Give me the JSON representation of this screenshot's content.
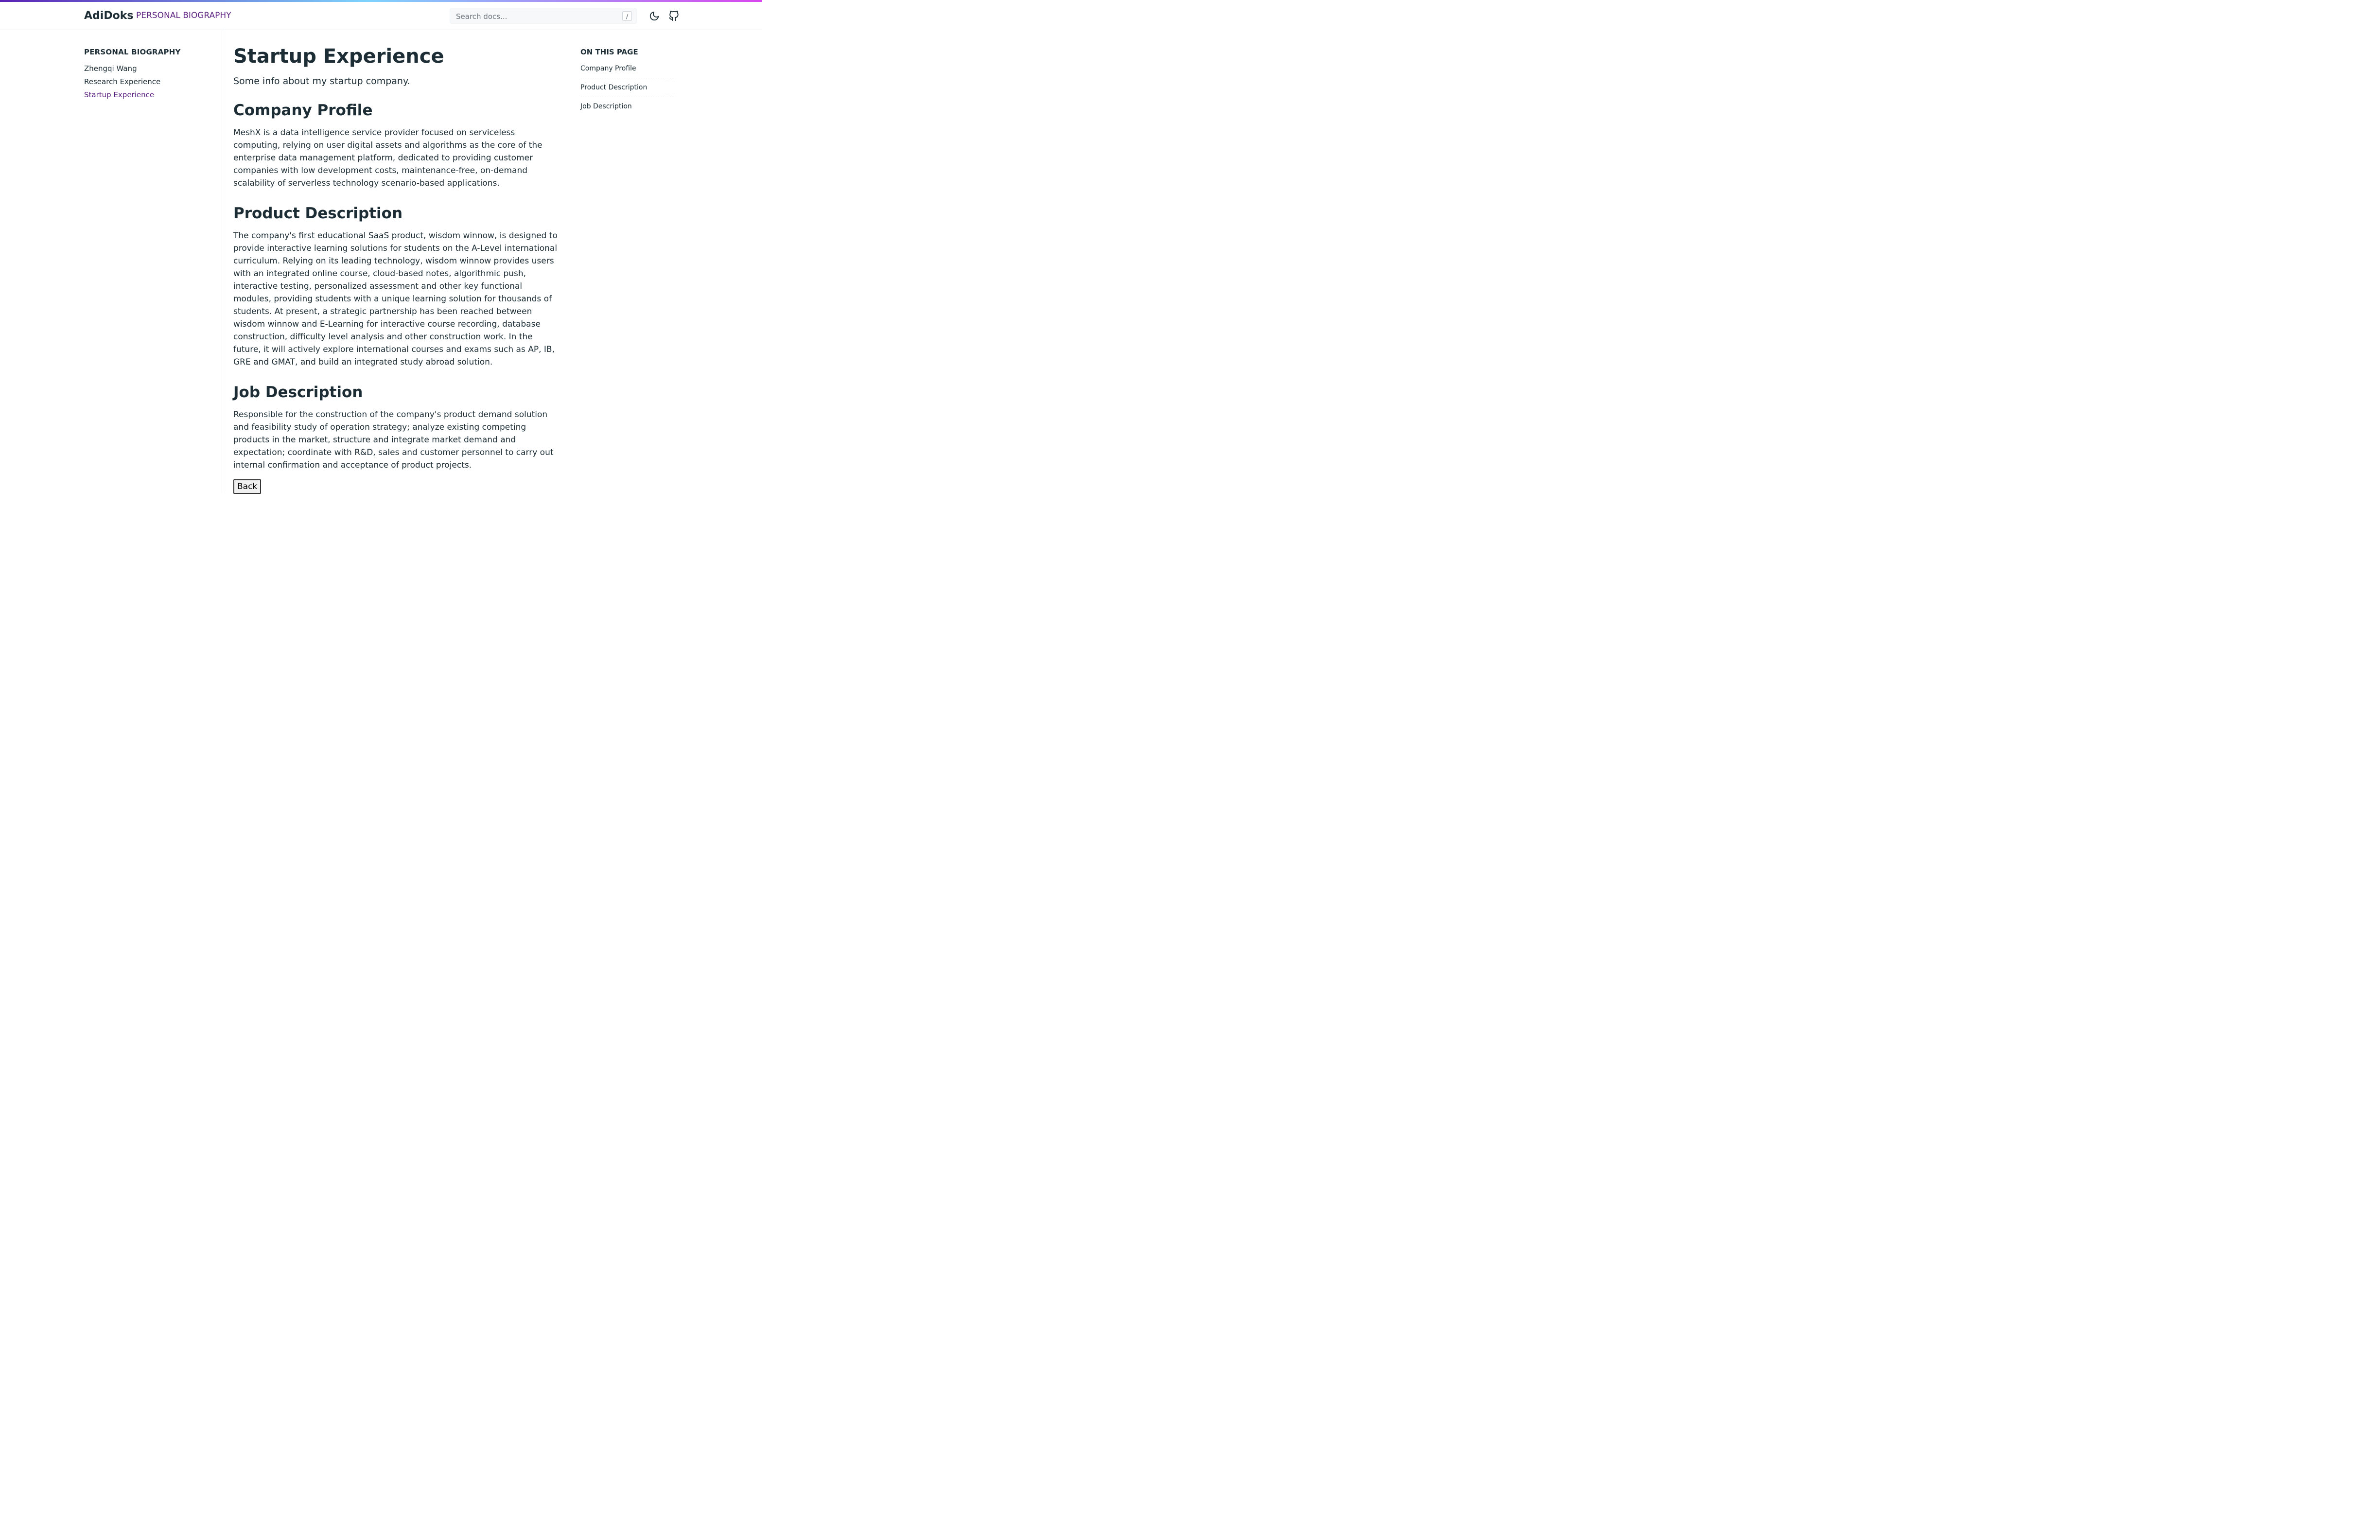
{
  "header": {
    "brand": "AdiDoks",
    "section": "PERSONAL BIOGRAPHY",
    "search_placeholder": "Search docs...",
    "search_shortcut": "/",
    "icons": [
      "moon-icon",
      "github-icon"
    ],
    "accent_gradient": [
      "#5b21b6",
      "#7dd3fc",
      "#d946ef"
    ]
  },
  "sidebar": {
    "heading": "PERSONAL BIOGRAPHY",
    "items": [
      {
        "label": "Zhengqi Wang"
      },
      {
        "label": "Research Experience"
      },
      {
        "label": "Startup Experience",
        "active": true
      }
    ],
    "active_color": "#5b1f80"
  },
  "main": {
    "title": "Startup Experience",
    "lead": "Some info about my startup company.",
    "sections": [
      {
        "heading": "Company Profile",
        "body": "MeshX is a data intelligence service provider focused on serviceless computing, relying on user digital assets and algorithms as the core of the enterprise data management platform, dedicated to providing customer companies with low development costs, maintenance-free, on-demand scalability of serverless technology scenario-based applications."
      },
      {
        "heading": "Product Description",
        "body": "The company's first educational SaaS product, wisdom winnow, is designed to provide interactive learning solutions for students on the A-Level international curriculum. Relying on its leading technology, wisdom winnow provides users with an integrated online course, cloud-based notes, algorithmic push, interactive testing, personalized assessment and other key functional modules, providing students with a unique learning solution for thousands of students. At present, a strategic partnership has been reached between wisdom winnow and E-Learning for interactive course recording, database construction, difficulty level analysis and other construction work. In the future, it will actively explore international courses and exams such as AP, IB, GRE and GMAT, and build an integrated study abroad solution."
      },
      {
        "heading": "Job Description",
        "body": "Responsible for the construction of the company's product demand solution and feasibility study of operation strategy; analyze existing competing products in the market, structure and integrate market demand and expectation; coordinate with R&D, sales and customer personnel to carry out internal confirmation and acceptance of product projects."
      }
    ],
    "back_label": "Back"
  },
  "toc": {
    "heading": "ON THIS PAGE",
    "items": [
      {
        "label": "Company Profile"
      },
      {
        "label": "Product Description"
      },
      {
        "label": "Job Description"
      }
    ]
  }
}
